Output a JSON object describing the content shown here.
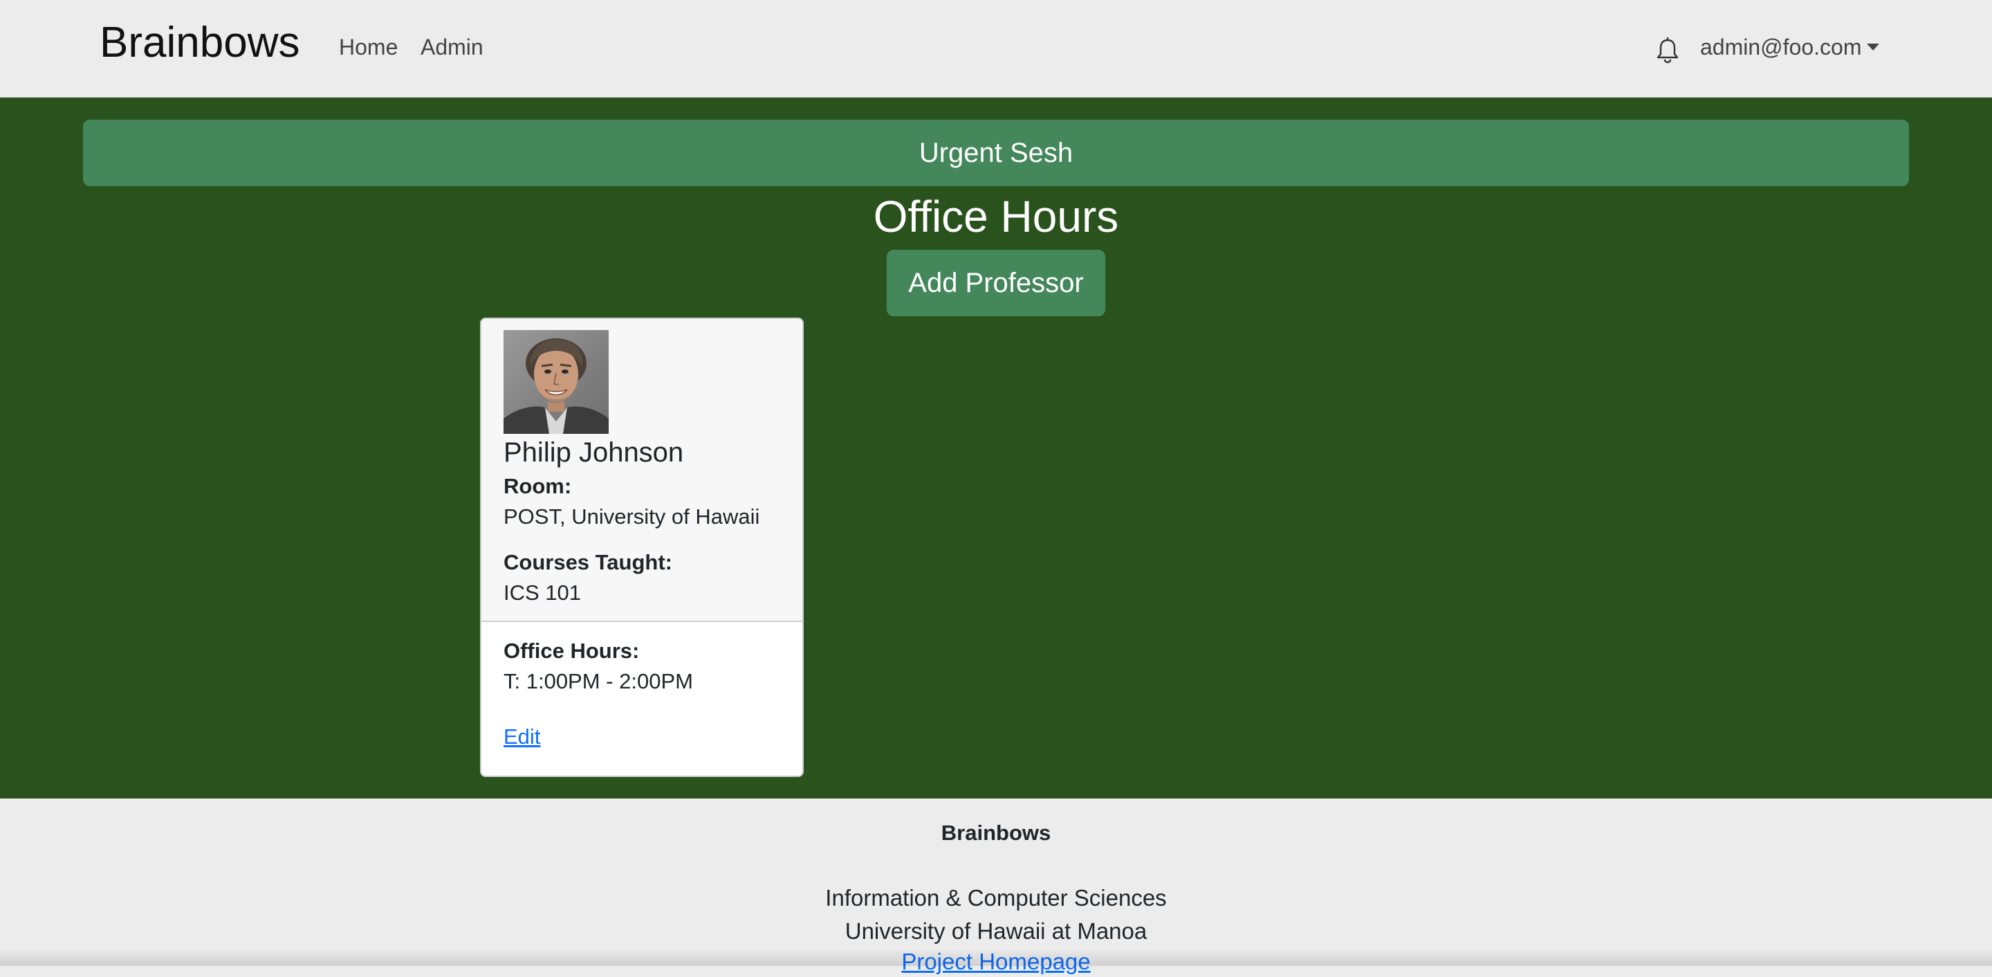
{
  "nav": {
    "brand": "Brainbows",
    "links": [
      "Home",
      "Admin"
    ],
    "user": "admin@foo.com"
  },
  "main": {
    "urgent_button": "Urgent Sesh",
    "title": "Office Hours",
    "add_button": "Add Professor"
  },
  "card": {
    "name": "Philip Johnson",
    "room_label": "Room:",
    "room": "POST, University of Hawaii",
    "courses_label": "Courses Taught:",
    "courses": "ICS 101",
    "office_hours_label": "Office Hours:",
    "office_hours": "T: 1:00PM - 2:00PM",
    "edit": "Edit"
  },
  "footer": {
    "brand": "Brainbows",
    "line1": "Information & Computer Sciences",
    "line2": "University of Hawaii at Manoa",
    "link": "Project Homepage"
  },
  "colors": {
    "main_bg": "#2a521d",
    "button_bg": "#43875b",
    "link": "#0d6efd"
  },
  "icons": [
    "bell-icon",
    "caret-down-icon"
  ]
}
